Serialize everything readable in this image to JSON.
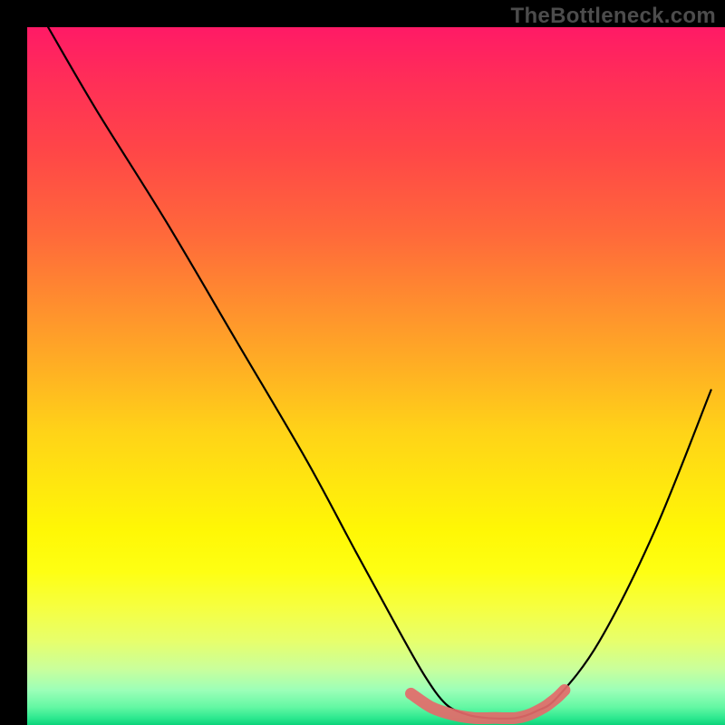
{
  "watermark": "TheBottleneck.com",
  "colors": {
    "bg": "#000000",
    "curve": "#000000",
    "highlight": "#e46a6a",
    "gradient_top": "#ff1a66",
    "gradient_mid": "#ffe80e",
    "gradient_bottom": "#0bd37a"
  },
  "chart_data": {
    "type": "line",
    "title": "",
    "xlabel": "",
    "ylabel": "",
    "xlim": [
      0,
      100
    ],
    "ylim": [
      0,
      100
    ],
    "annotation": "V-shaped bottleneck curve: steep left descent, flat trough near x≈60–70, right ascent; thick coral highlight on trough and start of ascent.",
    "series": [
      {
        "name": "bottleneck-curve",
        "x": [
          3,
          10,
          20,
          30,
          40,
          47,
          53,
          57,
          60,
          63,
          66,
          70,
          73,
          76,
          82,
          90,
          98
        ],
        "values": [
          100,
          88,
          72,
          55,
          38,
          25,
          14,
          7,
          3,
          1.5,
          1,
          1,
          2,
          4,
          12,
          28,
          48
        ]
      },
      {
        "name": "trough-highlight",
        "x": [
          55,
          58,
          61,
          64,
          67,
          70,
          72,
          74,
          75,
          76,
          77
        ],
        "values": [
          4.5,
          2.5,
          1.5,
          1,
          1,
          1,
          1.5,
          2.5,
          3.2,
          4,
          5
        ]
      }
    ]
  }
}
